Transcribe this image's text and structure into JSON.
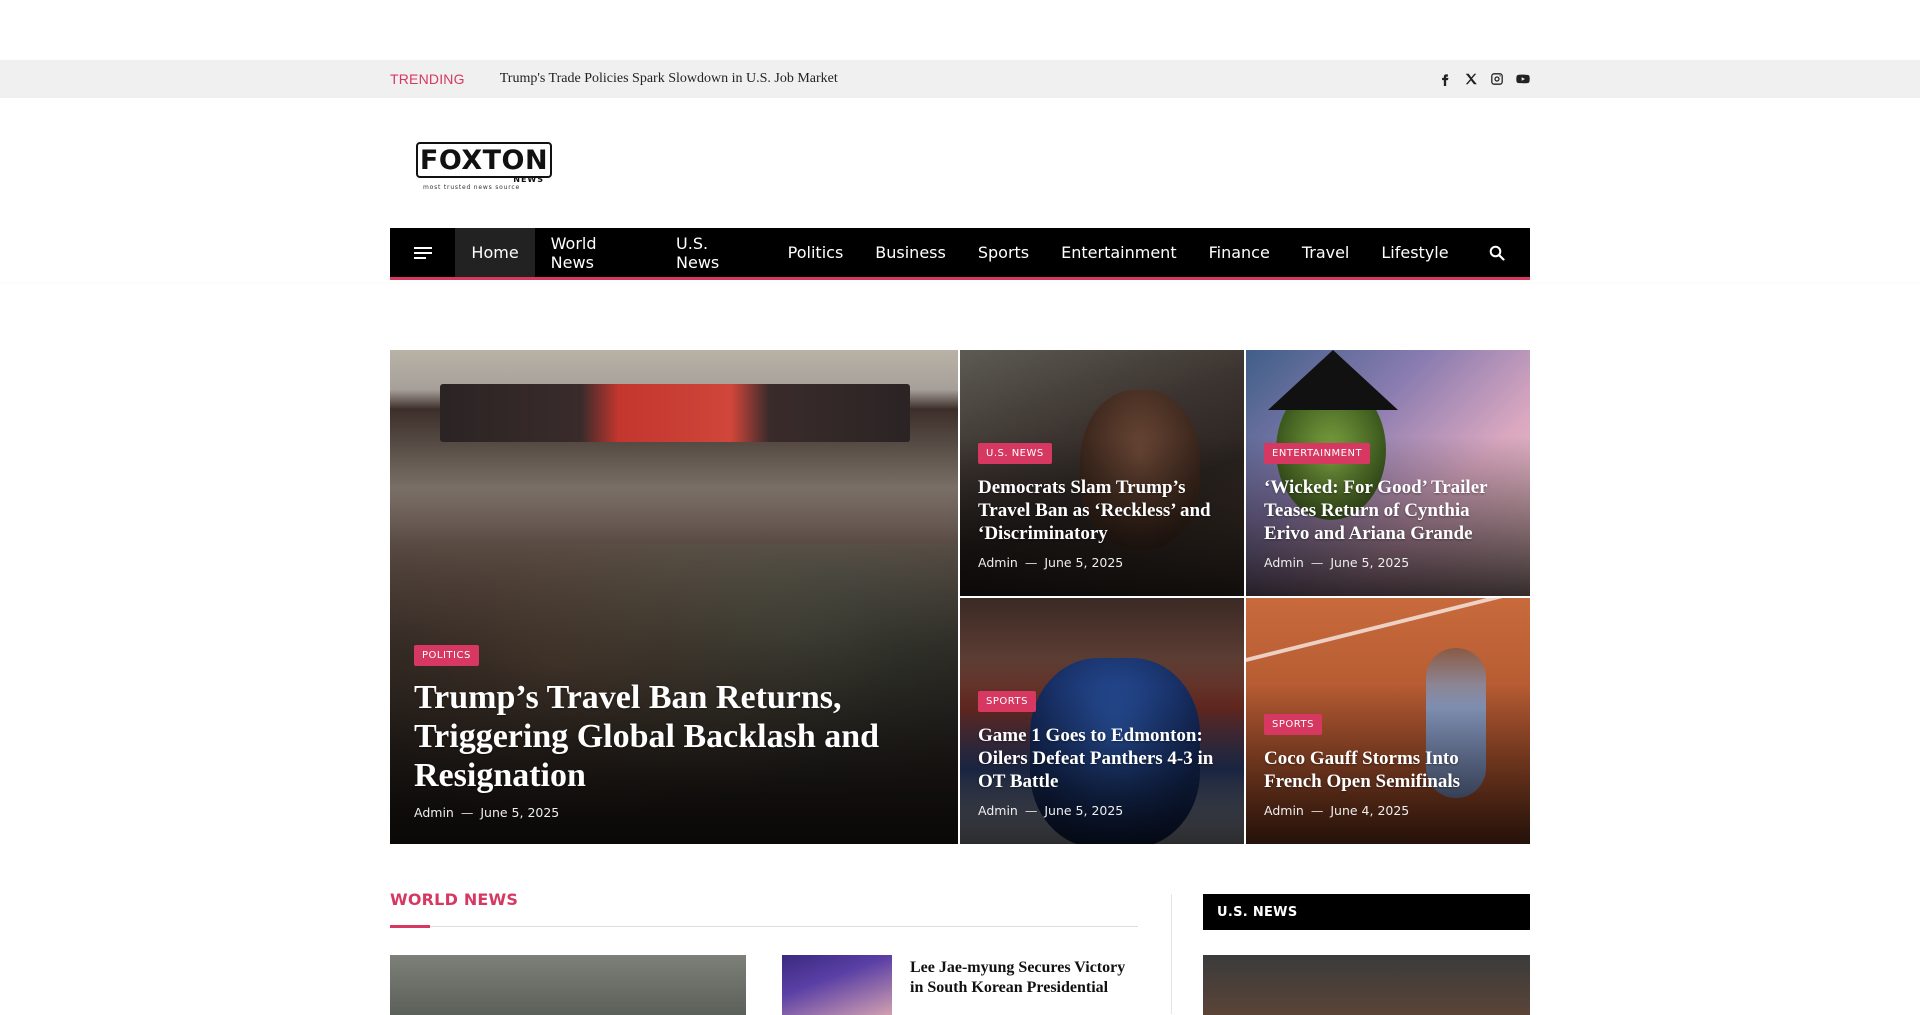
{
  "trending": {
    "label": "TRENDING",
    "headline": "Trump's Trade Policies Spark Slowdown in U.S. Job Market"
  },
  "socials": [
    "facebook-icon",
    "x-icon",
    "instagram-icon",
    "youtube-icon"
  ],
  "logo": {
    "name": "FOXTON",
    "sub": "NEWS",
    "tagline": "most trusted news source"
  },
  "nav": {
    "items": [
      "Home",
      "World News",
      "U.S. News",
      "Politics",
      "Business",
      "Sports",
      "Entertainment",
      "Finance",
      "Travel",
      "Lifestyle"
    ],
    "active": "Home"
  },
  "featured": [
    {
      "category": "POLITICS",
      "title": "Trump’s Travel Ban Returns, Triggering Global Backlash and Resignation",
      "author": "Admin",
      "date": "June 5, 2025"
    },
    {
      "category": "U.S. NEWS",
      "title": "Democrats Slam Trump’s Travel Ban as ‘Reckless’ and ‘Discriminatory",
      "author": "Admin",
      "date": "June 5, 2025"
    },
    {
      "category": "ENTERTAINMENT",
      "title": "‘Wicked: For Good’ Trailer Teases Return of Cynthia Erivo and Ariana Grande",
      "author": "Admin",
      "date": "June 5, 2025"
    },
    {
      "category": "SPORTS",
      "title": "Game 1 Goes to Edmonton: Oilers Defeat Panthers 4-3 in OT Battle",
      "author": "Admin",
      "date": "June 5, 2025"
    },
    {
      "category": "SPORTS",
      "title": "Coco Gauff Storms Into French Open Semifinals",
      "author": "Admin",
      "date": "June 4, 2025"
    }
  ],
  "sections": {
    "world_news": {
      "title": "WORLD NEWS",
      "item_title": "Lee Jae-myung Secures Victory in South Korean Presidential"
    },
    "us_news": {
      "title": "U.S. NEWS"
    }
  },
  "meta_separator": "—",
  "colors": {
    "accent": "#d63862",
    "nav_bg": "#000000",
    "trending_bg": "#f0f0f0"
  }
}
